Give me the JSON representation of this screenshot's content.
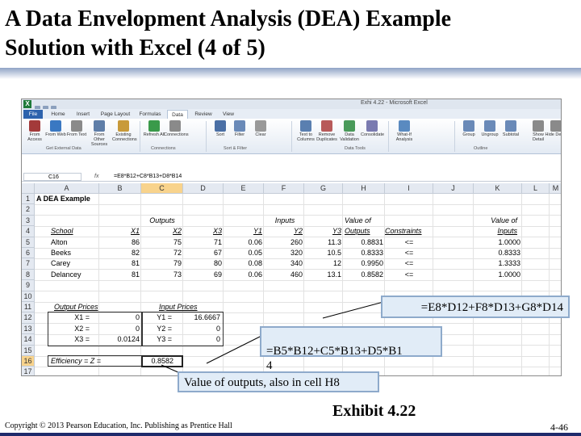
{
  "slide": {
    "title_line1": "A Data Envelopment Analysis (DEA) Example",
    "title_line2": "Solution with Excel (4 of 5)",
    "exhibit": "Exhibit 4.22",
    "copyright": "Copyright © 2013 Pearson Education, Inc. Publishing as Prentice Hall",
    "page_number": "4-46"
  },
  "excel": {
    "app_icon": "X",
    "window_title": "Exhi 4.22 - Microsoft Excel",
    "tabs": [
      "File",
      "Home",
      "Insert",
      "Page Layout",
      "Formulas",
      "Data",
      "Review",
      "View"
    ],
    "active_tab": "Data",
    "ribbon_buttons": [
      {
        "label": "From Access",
        "icon": "access-icon",
        "color": "#a33a3a"
      },
      {
        "label": "From Web",
        "icon": "globe-icon",
        "color": "#3a78c2"
      },
      {
        "label": "From Text",
        "icon": "text-file-icon",
        "color": "#8a8a8a"
      },
      {
        "label": "From Other Sources",
        "icon": "database-icon",
        "color": "#5f7ea8"
      },
      {
        "label": "Existing Connections",
        "icon": "connection-icon",
        "color": "#c89a3a"
      },
      {
        "label": "Refresh All",
        "icon": "refresh-icon",
        "color": "#3a9a4a"
      },
      {
        "label": "Connections",
        "icon": "connections-icon",
        "color": "#8a8a8a"
      },
      {
        "label": "Sort",
        "icon": "sort-icon",
        "color": "#4a6fa5"
      },
      {
        "label": "Filter",
        "icon": "filter-icon",
        "color": "#6a8ab8"
      },
      {
        "label": "Clear",
        "icon": "clear-icon",
        "color": "#999999"
      },
      {
        "label": "Text to Columns",
        "icon": "text-columns-icon",
        "color": "#5a7fb0"
      },
      {
        "label": "Remove Duplicates",
        "icon": "remove-duplicates-icon",
        "color": "#b85a5a"
      },
      {
        "label": "Data Validation",
        "icon": "validation-icon",
        "color": "#4a9a5a"
      },
      {
        "label": "Consolidate",
        "icon": "consolidate-icon",
        "color": "#7a7ab0"
      },
      {
        "label": "What-If Analysis",
        "icon": "what-if-icon",
        "color": "#5a8ac0"
      },
      {
        "label": "Group",
        "icon": "group-icon",
        "color": "#6a8ab8"
      },
      {
        "label": "Ungroup",
        "icon": "ungroup-icon",
        "color": "#6a8ab8"
      },
      {
        "label": "Subtotal",
        "icon": "subtotal-icon",
        "color": "#6a8ab8"
      },
      {
        "label": "Show Detail",
        "icon": "show-detail-icon",
        "color": "#8a8a8a"
      },
      {
        "label": "Hide Detail",
        "icon": "hide-detail-icon",
        "color": "#8a8a8a"
      }
    ],
    "ribbon_groups": [
      "Get External Data",
      "Connections",
      "Sort & Filter",
      "Data Tools",
      "Outline"
    ],
    "name_box": "C16",
    "fx_label": "fx",
    "formula": "=E8*B12+C8*B13+D8*B14",
    "columns": [
      "A",
      "B",
      "C",
      "D",
      "E",
      "F",
      "G",
      "H",
      "I",
      "J",
      "K",
      "L",
      "M"
    ],
    "rows": [
      "1",
      "2",
      "3",
      "4",
      "5",
      "6",
      "7",
      "8",
      "9",
      "10",
      "11",
      "12",
      "13",
      "14",
      "15",
      "16",
      "17"
    ],
    "sheet": {
      "a1": "A DEA Example",
      "outputs_header": "Outputs",
      "inputs_header": "Inputs",
      "value_of_header": "Value of",
      "value_of_header2": "Value of",
      "outputs_col": "Outputs",
      "constraints_col": "Constraints",
      "inputs_col": "Inputs",
      "col_headers": [
        "School",
        "X1",
        "X2",
        "X3",
        "Y1",
        "Y2",
        "Y3"
      ],
      "data_rows": [
        {
          "school": "Alton",
          "x1": "86",
          "x2": "75",
          "x3": "71",
          "y1": "0.06",
          "y2": "260",
          "y3": "11.3",
          "out": "0.8831",
          "con": "<=",
          "inp": "1.0000"
        },
        {
          "school": "Beeks",
          "x1": "82",
          "x2": "72",
          "x3": "67",
          "y1": "0.05",
          "y2": "320",
          "y3": "10.5",
          "out": "0.8333",
          "con": "<=",
          "inp": "0.8333"
        },
        {
          "school": "Carey",
          "x1": "81",
          "x2": "79",
          "x3": "80",
          "y1": "0.08",
          "y2": "340",
          "y3": "12",
          "out": "0.9950",
          "con": "<=",
          "inp": "1.3333"
        },
        {
          "school": "Delancey",
          "x1": "81",
          "x2": "73",
          "x3": "69",
          "y1": "0.06",
          "y2": "460",
          "y3": "13.1",
          "out": "0.8582",
          "con": "<=",
          "inp": "1.0000"
        }
      ],
      "output_prices_label": "Output Prices",
      "input_prices_label": "Input Prices",
      "price_rows": [
        {
          "xl": "X1 =",
          "xv": "0",
          "yl": "Y1 =",
          "yv": "16.6667"
        },
        {
          "xl": "X2 =",
          "xv": "0",
          "yl": "Y2 =",
          "yv": "0"
        },
        {
          "xl": "X3 =",
          "xv": "0.0124",
          "yl": "Y3 =",
          "yv": "0"
        }
      ],
      "efficiency_label": "Efficiency = Z =",
      "efficiency_value": "0.8582"
    }
  },
  "callouts": {
    "top": "=E8*D12+F8*D13+G8*D14",
    "middle": "=B5*B12+C5*B13+D5*B1\n4",
    "bottom": "Value of outputs, also in cell H8"
  }
}
